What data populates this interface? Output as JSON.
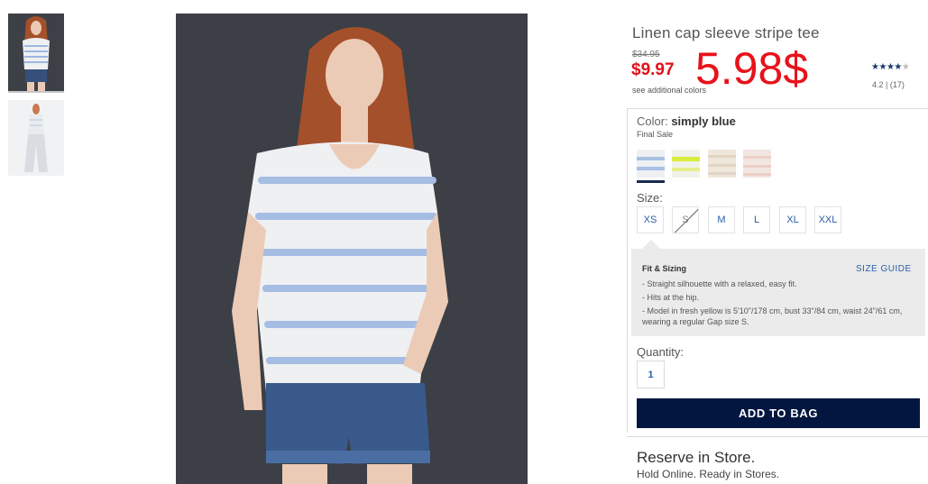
{
  "product": {
    "title": "Linen cap sleeve stripe tee",
    "original_price": "$34.95",
    "sale_price": "$9.97",
    "see_colors": "see additional colors",
    "annotation": "5.98$",
    "stars": 4,
    "stars_max": 5,
    "rating_text": "4.2  |  (17)"
  },
  "color": {
    "label": "Color:",
    "selected": "simply blue",
    "final_sale": "Final Sale",
    "swatches": [
      "simply blue",
      "fresh yellow",
      "oatmeal",
      "pink stripe"
    ]
  },
  "size": {
    "label": "Size:",
    "options": [
      "XS",
      "S",
      "M",
      "L",
      "XL",
      "XXL"
    ],
    "unavailable": [
      "S"
    ]
  },
  "fit": {
    "title": "Fit & Sizing",
    "size_guide": "SIZE GUIDE",
    "items": [
      "- Straight silhouette with a relaxed, easy fit.",
      "- Hits at the hip.",
      "- Model in fresh yellow is 5'10\"/178 cm, bust 33\"/84 cm, waist 24\"/61 cm, wearing a regular Gap size S."
    ]
  },
  "quantity": {
    "label": "Quantity:",
    "value": "1"
  },
  "cart": {
    "add_label": "ADD TO BAG"
  },
  "reserve": {
    "title": "Reserve in Store.",
    "subtitle": "Hold Online. Ready in Stores."
  },
  "colors": {
    "accent_red": "#e0121a",
    "navy": "#03163f",
    "link_blue": "#2a5ea8"
  }
}
